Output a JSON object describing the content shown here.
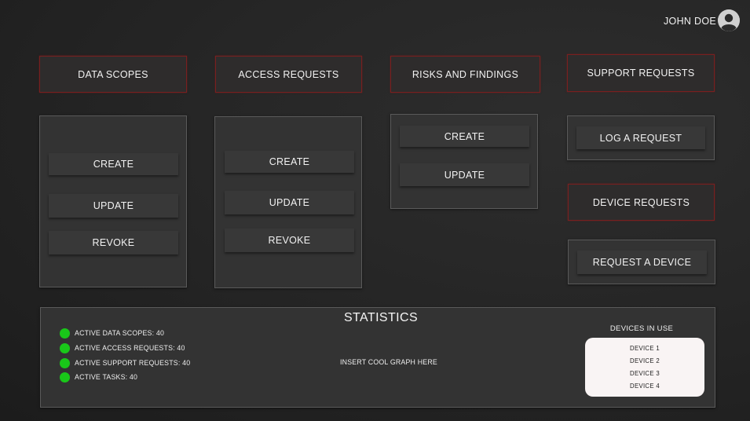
{
  "user": {
    "name": "JOHN DOE",
    "avatar_icon": "user-circle-icon"
  },
  "sections": {
    "data_scopes": {
      "title": "DATA SCOPES",
      "actions": [
        "CREATE",
        "UPDATE",
        "REVOKE"
      ]
    },
    "access_requests": {
      "title": "ACCESS REQUESTS",
      "actions": [
        "CREATE",
        "UPDATE",
        "REVOKE"
      ]
    },
    "risks_findings": {
      "title": "RISKS AND FINDINGS",
      "actions": [
        "CREATE",
        "UPDATE"
      ]
    },
    "support_requests": {
      "title": "SUPPORT REQUESTS",
      "actions": [
        "LOG A REQUEST"
      ]
    },
    "device_requests": {
      "title": "DEVICE REQUESTS",
      "actions": [
        "REQUEST A DEVICE"
      ]
    }
  },
  "statistics": {
    "title": "STATISTICS",
    "items": [
      "ACTIVE DATA SCOPES: 40",
      "ACTIVE ACCESS REQUESTS: 40",
      "ACTIVE SUPPORT REQUESTS: 40",
      "ACTIVE TASKS: 40"
    ],
    "graph_placeholder": "INSERT COOL GRAPH HERE",
    "devices_title": "DEVICES IN USE",
    "devices": [
      "DEVICE 1",
      "DEVICE 2",
      "DEVICE 3",
      "DEVICE 4"
    ]
  },
  "colors": {
    "background": "#262626",
    "panel": "#333333",
    "header_border": "#7a1f1f",
    "status_dot": "#19c719",
    "devices_box": "#f9f4f4"
  }
}
